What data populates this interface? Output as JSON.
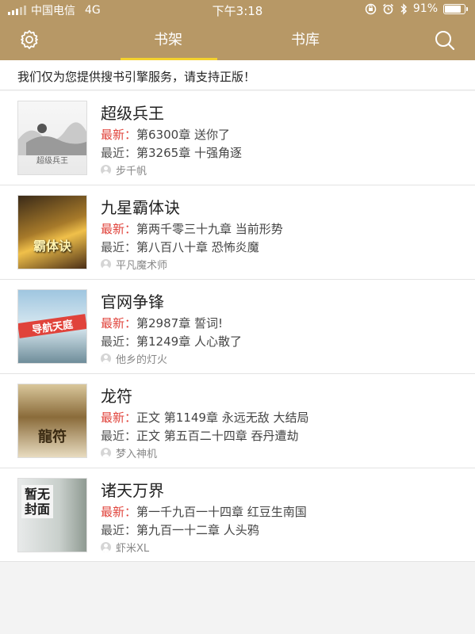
{
  "status": {
    "carrier": "中国电信",
    "network": "4G",
    "time": "下午3:18",
    "battery": "91%",
    "battery_level": 0.91
  },
  "nav": {
    "tabs": [
      {
        "label": "书架",
        "active": true
      },
      {
        "label": "书库",
        "active": false
      }
    ]
  },
  "notice": "我们仅为您提供搜书引擎服务，请支持正版！",
  "labels": {
    "newest": "最新：",
    "recent": "最近："
  },
  "books": [
    {
      "title": "超级兵王",
      "newest": "第6300章 送你了",
      "recent": "第3265章 十强角逐",
      "author": "步千帆",
      "cover_text": "超级兵王"
    },
    {
      "title": "九星霸体诀",
      "newest": "第两千零三十九章 当前形势",
      "recent": "第八百八十章 恐怖炎魔",
      "author": "平凡魔术师",
      "cover_text": "霸体诀"
    },
    {
      "title": "官网争锋",
      "newest": "第2987章 誓词!",
      "recent": "第1249章 人心散了",
      "author": "他乡的灯火",
      "cover_text": "导航天庭"
    },
    {
      "title": "龙符",
      "newest": "正文 第1149章  永远无敌 大结局",
      "recent": "正文 第五百二十四章 吞丹遭劫",
      "author": "梦入神机",
      "cover_text": "龍符"
    },
    {
      "title": "诸天万界",
      "newest": "第一千九百一十四章 红豆生南国",
      "recent": "第九百一十二章 人头鸦",
      "author": "虾米XL",
      "cover_text": "暂无封面"
    }
  ],
  "colors": {
    "header": "#b79866",
    "tab_indicator": "#f4d22d",
    "newest_label": "#e0433b"
  }
}
